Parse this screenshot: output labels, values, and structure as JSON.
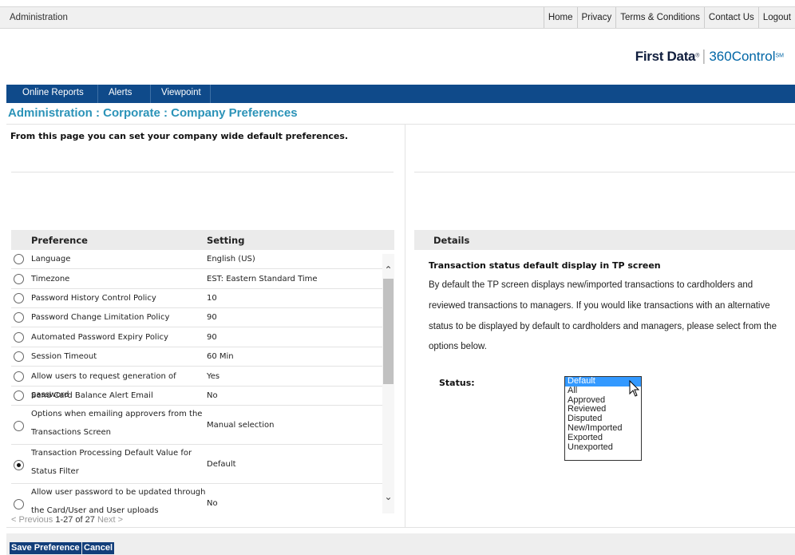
{
  "header": {
    "section": "Administration",
    "links": [
      "Home",
      "Privacy",
      "Terms & Conditions",
      "Contact Us",
      "Logout"
    ]
  },
  "logo": {
    "brand": "First Data",
    "reg": "®",
    "product": "360Control",
    "tm": "SM"
  },
  "nav": {
    "items": [
      "Online Reports",
      "Alerts",
      "Viewpoint"
    ]
  },
  "page": {
    "title": "Administration : Corporate : Company Preferences",
    "intro": "From this page you can set your company wide default preferences."
  },
  "table": {
    "col_preference": "Preference",
    "col_setting": "Setting",
    "rows": [
      {
        "preference": "Language",
        "setting": "English (US)"
      },
      {
        "preference": "Timezone",
        "setting": "EST: Eastern Standard Time"
      },
      {
        "preference": "Password History Control Policy",
        "setting": "10"
      },
      {
        "preference": "Password Change Limitation Policy",
        "setting": "90"
      },
      {
        "preference": "Automated Password Expiry Policy",
        "setting": "90"
      },
      {
        "preference": "Session Timeout",
        "setting": "60 Min"
      },
      {
        "preference": "Allow users to request generation of password",
        "setting": "Yes"
      },
      {
        "preference": "Send Card Balance Alert Email",
        "setting": "No"
      },
      {
        "preference": "Options when emailing approvers from the Transactions Screen",
        "setting": "Manual selection"
      },
      {
        "preference": "Transaction Processing Default Value for Status Filter",
        "setting": "Default",
        "selected": true
      },
      {
        "preference": "Allow user password to be updated through the Card/User and User uploads",
        "setting": "No"
      }
    ]
  },
  "pager": {
    "prev": "< Previous",
    "range": "1-27 of 27",
    "next": "Next >"
  },
  "details": {
    "header": "Details",
    "title": "Transaction status default display in TP screen",
    "body": "By default the TP screen displays new/imported transactions to cardholders and reviewed transactions to managers. If you would like transactions with an alternative status to be displayed by default to cardholders and managers, please select from the options below.",
    "status_label": "Status:",
    "status_options": [
      "Default",
      "All",
      "Approved",
      "Reviewed",
      "Disputed",
      "New/Imported",
      "Exported",
      "Unexported"
    ],
    "selected_status": "Default"
  },
  "footer": {
    "save_label": "Save Preference",
    "cancel_label": "Cancel"
  }
}
